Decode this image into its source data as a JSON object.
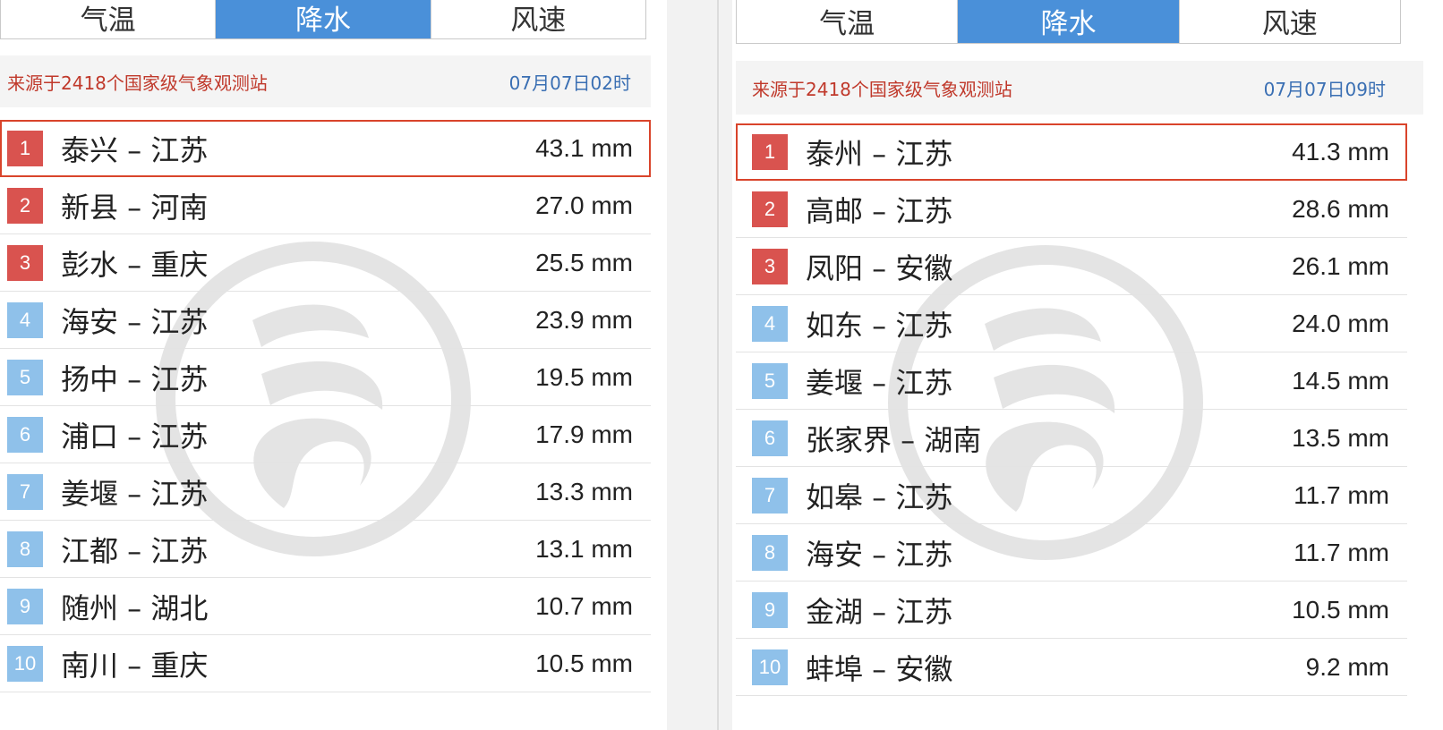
{
  "panels": [
    {
      "tabs": [
        {
          "label": "气温",
          "active": false
        },
        {
          "label": "降水",
          "active": true
        },
        {
          "label": "风速",
          "active": false
        }
      ],
      "source": "来源于2418个国家级气象观测站",
      "time": "07月07日02时",
      "rows": [
        {
          "rank": "1",
          "station": "泰兴 – 江苏",
          "amount": "43.1 mm"
        },
        {
          "rank": "2",
          "station": "新县 – 河南",
          "amount": "27.0 mm"
        },
        {
          "rank": "3",
          "station": "彭水 – 重庆",
          "amount": "25.5 mm"
        },
        {
          "rank": "4",
          "station": "海安 – 江苏",
          "amount": "23.9 mm"
        },
        {
          "rank": "5",
          "station": "扬中 – 江苏",
          "amount": "19.5 mm"
        },
        {
          "rank": "6",
          "station": "浦口 – 江苏",
          "amount": "17.9 mm"
        },
        {
          "rank": "7",
          "station": "姜堰 – 江苏",
          "amount": "13.3 mm"
        },
        {
          "rank": "8",
          "station": "江都 – 江苏",
          "amount": "13.1 mm"
        },
        {
          "rank": "9",
          "station": "随州 – 湖北",
          "amount": "10.7 mm"
        },
        {
          "rank": "10",
          "station": "南川 – 重庆",
          "amount": "10.5 mm"
        }
      ]
    },
    {
      "tabs": [
        {
          "label": "气温",
          "active": false
        },
        {
          "label": "降水",
          "active": true
        },
        {
          "label": "风速",
          "active": false
        }
      ],
      "source": "来源于2418个国家级气象观测站",
      "time": "07月07日09时",
      "rows": [
        {
          "rank": "1",
          "station": "泰州 – 江苏",
          "amount": "41.3 mm"
        },
        {
          "rank": "2",
          "station": "高邮 – 江苏",
          "amount": "28.6 mm"
        },
        {
          "rank": "3",
          "station": "凤阳 – 安徽",
          "amount": "26.1 mm"
        },
        {
          "rank": "4",
          "station": "如东 – 江苏",
          "amount": "24.0 mm"
        },
        {
          "rank": "5",
          "station": "姜堰 – 江苏",
          "amount": "14.5 mm"
        },
        {
          "rank": "6",
          "station": "张家界 – 湖南",
          "amount": "13.5 mm"
        },
        {
          "rank": "7",
          "station": "如皋 – 江苏",
          "amount": "11.7 mm"
        },
        {
          "rank": "8",
          "station": "海安 – 江苏",
          "amount": "11.7 mm"
        },
        {
          "rank": "9",
          "station": "金湖 – 江苏",
          "amount": "10.5 mm"
        },
        {
          "rank": "10",
          "station": "蚌埠 – 安徽",
          "amount": "9.2 mm"
        }
      ]
    }
  ],
  "colors": {
    "active_tab": "#4a90d9",
    "source_text": "#c0392b",
    "time_text": "#3a6fb3",
    "badge_top": "#d9534f",
    "badge_normal": "#8fc1ea",
    "highlight_border": "#d9442b"
  },
  "icons": {
    "watermark": "swirl-emblem-icon"
  }
}
